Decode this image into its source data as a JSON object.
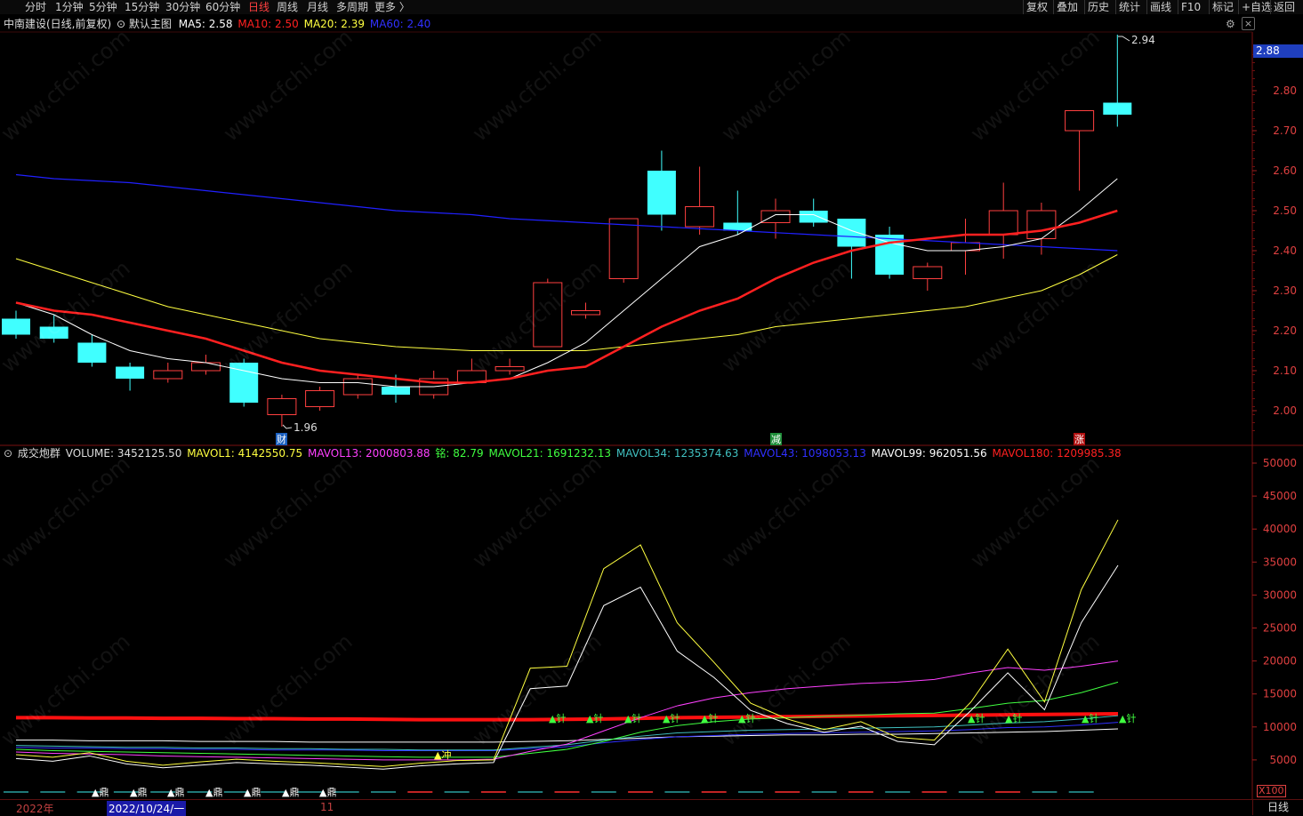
{
  "toolbar": {
    "timeframes": [
      "分时",
      "1分钟",
      "5分钟",
      "15分钟",
      "30分钟",
      "60分钟",
      "日线",
      "周线",
      "月线",
      "多周期",
      "更多 〉"
    ],
    "active": "日线",
    "right_buttons": [
      "复权",
      "叠加",
      "历史",
      "统计",
      "画线",
      "F10",
      "标记",
      "+自选",
      "返回"
    ]
  },
  "main_legend": {
    "stock": "中南建设(日线,前复权)",
    "template": "默认主图",
    "ma5": "MA5: 2.58",
    "ma10": "MA10: 2.50",
    "ma20": "MA20: 2.39",
    "ma60": "MA60: 2.40"
  },
  "price_axis": [
    "2.80",
    "2.70",
    "2.60",
    "2.50",
    "2.40",
    "2.30",
    "2.20",
    "2.10",
    "2.00"
  ],
  "current_price": "2.88",
  "high_label": "2.94",
  "low_label": "1.96",
  "event_markers": [
    "财",
    "减",
    "涨"
  ],
  "volume_legend": {
    "name": "成交炮群",
    "volume": "VOLUME: 3452125.50",
    "mavol1": "MAVOL1: 4142550.75",
    "mavol13": "MAVOL13: 2000803.88",
    "ming": "铭: 82.79",
    "mavol21": "MAVOL21: 1691232.13",
    "mavol34": "MAVOL34: 1235374.63",
    "mavol43": "MAVOL43: 1098053.13",
    "mavol99": "MAVOL99: 962051.56",
    "mavol180": "MAVOL180: 1209985.38"
  },
  "volume_axis": [
    "50000",
    "45000",
    "40000",
    "35000",
    "30000",
    "25000",
    "20000",
    "15000",
    "10000",
    "5000"
  ],
  "volume_unit": "X100",
  "vol_signals": {
    "chong": "▲冲",
    "ding": "▲鼎",
    "zhen": "▲针"
  },
  "date_axis": {
    "year": "2022年",
    "selected": "2022/10/24/一",
    "month": "11",
    "period": "日线"
  },
  "colors": {
    "ma5": "#ffffff",
    "ma10": "#ff2020",
    "ma20": "#ffff40",
    "ma60": "#2020ff",
    "up": "#ff4040",
    "down": "#40ffff"
  },
  "candles": [
    {
      "o": 2.23,
      "c": 2.19,
      "h": 2.25,
      "l": 2.18
    },
    {
      "o": 2.21,
      "c": 2.18,
      "h": 2.24,
      "l": 2.17
    },
    {
      "o": 2.17,
      "c": 2.12,
      "h": 2.19,
      "l": 2.11
    },
    {
      "o": 2.11,
      "c": 2.08,
      "h": 2.12,
      "l": 2.05
    },
    {
      "o": 2.08,
      "c": 2.1,
      "h": 2.12,
      "l": 2.07
    },
    {
      "o": 2.1,
      "c": 2.12,
      "h": 2.14,
      "l": 2.09
    },
    {
      "o": 2.12,
      "c": 2.02,
      "h": 2.13,
      "l": 2.01
    },
    {
      "o": 1.99,
      "c": 2.03,
      "h": 2.04,
      "l": 1.96
    },
    {
      "o": 2.01,
      "c": 2.05,
      "h": 2.06,
      "l": 2.0
    },
    {
      "o": 2.04,
      "c": 2.08,
      "h": 2.09,
      "l": 2.03
    },
    {
      "o": 2.06,
      "c": 2.04,
      "h": 2.09,
      "l": 2.02
    },
    {
      "o": 2.04,
      "c": 2.08,
      "h": 2.1,
      "l": 2.03
    },
    {
      "o": 2.07,
      "c": 2.1,
      "h": 2.13,
      "l": 2.07
    },
    {
      "o": 2.1,
      "c": 2.11,
      "h": 2.13,
      "l": 2.09
    },
    {
      "o": 2.16,
      "c": 2.32,
      "h": 2.33,
      "l": 2.16
    },
    {
      "o": 2.24,
      "c": 2.25,
      "h": 2.27,
      "l": 2.23
    },
    {
      "o": 2.33,
      "c": 2.48,
      "h": 2.48,
      "l": 2.32
    },
    {
      "o": 2.6,
      "c": 2.49,
      "h": 2.65,
      "l": 2.45
    },
    {
      "o": 2.46,
      "c": 2.51,
      "h": 2.61,
      "l": 2.44
    },
    {
      "o": 2.47,
      "c": 2.45,
      "h": 2.55,
      "l": 2.44
    },
    {
      "o": 2.47,
      "c": 2.5,
      "h": 2.53,
      "l": 2.43
    },
    {
      "o": 2.5,
      "c": 2.47,
      "h": 2.53,
      "l": 2.46
    },
    {
      "o": 2.48,
      "c": 2.41,
      "h": 2.48,
      "l": 2.33
    },
    {
      "o": 2.44,
      "c": 2.34,
      "h": 2.46,
      "l": 2.33
    },
    {
      "o": 2.33,
      "c": 2.36,
      "h": 2.37,
      "l": 2.3
    },
    {
      "o": 2.4,
      "c": 2.42,
      "h": 2.48,
      "l": 2.34
    },
    {
      "o": 2.44,
      "c": 2.5,
      "h": 2.57,
      "l": 2.38
    },
    {
      "o": 2.43,
      "c": 2.5,
      "h": 2.52,
      "l": 2.39
    },
    {
      "o": 2.7,
      "c": 2.75,
      "h": 2.75,
      "l": 2.55
    },
    {
      "o": 2.77,
      "c": 2.74,
      "h": 2.94,
      "l": 2.71
    }
  ],
  "ma_lines": {
    "ma5": [
      2.27,
      2.24,
      2.19,
      2.15,
      2.13,
      2.12,
      2.1,
      2.08,
      2.07,
      2.07,
      2.06,
      2.06,
      2.07,
      2.08,
      2.12,
      2.17,
      2.25,
      2.33,
      2.41,
      2.44,
      2.49,
      2.49,
      2.45,
      2.42,
      2.4,
      2.4,
      2.41,
      2.43,
      2.5,
      2.58
    ],
    "ma10": [
      2.27,
      2.25,
      2.24,
      2.22,
      2.2,
      2.18,
      2.15,
      2.12,
      2.1,
      2.09,
      2.08,
      2.07,
      2.07,
      2.08,
      2.1,
      2.11,
      2.16,
      2.21,
      2.25,
      2.28,
      2.33,
      2.37,
      2.4,
      2.42,
      2.43,
      2.44,
      2.44,
      2.45,
      2.47,
      2.5
    ],
    "ma20": [
      2.38,
      2.35,
      2.32,
      2.29,
      2.26,
      2.24,
      2.22,
      2.2,
      2.18,
      2.17,
      2.16,
      2.155,
      2.15,
      2.15,
      2.15,
      2.15,
      2.16,
      2.17,
      2.18,
      2.19,
      2.21,
      2.22,
      2.23,
      2.24,
      2.25,
      2.26,
      2.28,
      2.3,
      2.34,
      2.39
    ],
    "ma60": [
      2.59,
      2.58,
      2.575,
      2.57,
      2.56,
      2.55,
      2.54,
      2.53,
      2.52,
      2.51,
      2.5,
      2.495,
      2.49,
      2.48,
      2.475,
      2.47,
      2.465,
      2.46,
      2.455,
      2.45,
      2.445,
      2.44,
      2.435,
      2.43,
      2.425,
      2.42,
      2.415,
      2.41,
      2.405,
      2.4
    ]
  },
  "vol_series": {
    "vol": [
      5200,
      4800,
      5600,
      4400,
      3800,
      4200,
      4600,
      4400,
      4200,
      3900,
      3600,
      4100,
      4400,
      4600,
      15800,
      16200,
      28400,
      31200,
      21500,
      17500,
      12500,
      10500,
      9200,
      10100,
      7800,
      7300,
      12500,
      18200,
      12600,
      25800,
      34500
    ],
    "mavol1": [
      5800,
      5400,
      6100,
      4800,
      4200,
      4700,
      5100,
      4800,
      4600,
      4300,
      4000,
      4500,
      4900,
      5000,
      18900,
      19200,
      34000,
      37600,
      25800,
      19800,
      13600,
      11200,
      9600,
      10800,
      8400,
      8000,
      13800,
      21800,
      13800,
      30800,
      41400
    ],
    "mavol13": [
      6200,
      6000,
      5900,
      5800,
      5600,
      5500,
      5400,
      5300,
      5200,
      5100,
      5000,
      5000,
      5000,
      5100,
      6300,
      7400,
      9400,
      11400,
      13200,
      14400,
      15200,
      15800,
      16200,
      16600,
      16800,
      17200,
      18200,
      19000,
      18600,
      19200,
      20000
    ],
    "mavol21": [
      6600,
      6400,
      6300,
      6200,
      6100,
      6000,
      5900,
      5800,
      5700,
      5600,
      5500,
      5400,
      5400,
      5400,
      6000,
      6600,
      7800,
      9200,
      10200,
      10800,
      11200,
      11400,
      11600,
      11800,
      12000,
      12100,
      12800,
      13600,
      14000,
      15200,
      16800
    ],
    "mavol34": [
      7200,
      7100,
      7000,
      6900,
      6900,
      6800,
      6800,
      6700,
      6700,
      6600,
      6600,
      6500,
      6500,
      6500,
      6900,
      7300,
      8000,
      8600,
      9100,
      9300,
      9500,
      9600,
      9700,
      9800,
      9900,
      10000,
      10300,
      10600,
      10800,
      11200,
      11700
    ],
    "mavol99": [
      8000,
      8000,
      7900,
      7900,
      7900,
      7800,
      7800,
      7800,
      7700,
      7700,
      7700,
      7700,
      7700,
      7700,
      7800,
      7900,
      8100,
      8300,
      8500,
      8600,
      8700,
      8800,
      8800,
      8900,
      8900,
      9000,
      9100,
      9200,
      9300,
      9500,
      9700
    ],
    "mavol43": [
      6900,
      6800,
      6800,
      6700,
      6700,
      6600,
      6600,
      6500,
      6500,
      6500,
      6400,
      6400,
      6400,
      6400,
      6700,
      7000,
      7600,
      8100,
      8500,
      8700,
      8900,
      9000,
      9100,
      9200,
      9300,
      9400,
      9600,
      9900,
      10000,
      10300,
      10700
    ],
    "mavol180": [
      11400,
      11400,
      11350,
      11350,
      11300,
      11300,
      11250,
      11250,
      11200,
      11200,
      11150,
      11100,
      11100,
      11100,
      11100,
      11150,
      11200,
      11300,
      11400,
      11450,
      11500,
      11550,
      11600,
      11650,
      11700,
      11750,
      11800,
      11850,
      11900,
      11950,
      12000
    ]
  }
}
